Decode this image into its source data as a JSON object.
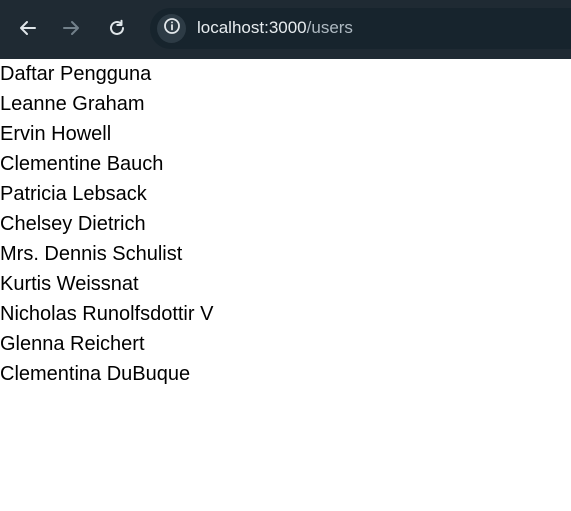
{
  "browser": {
    "url_host": "localhost:3000",
    "url_path": "/users",
    "icons": [
      "back-arrow-icon",
      "forward-arrow-icon",
      "reload-icon",
      "info-icon"
    ]
  },
  "page": {
    "title": "Daftar Pengguna",
    "users": [
      "Leanne Graham",
      "Ervin Howell",
      "Clementine Bauch",
      "Patricia Lebsack",
      "Chelsey Dietrich",
      "Mrs. Dennis Schulist",
      "Kurtis Weissnat",
      "Nicholas Runolfsdottir V",
      "Glenna Reichert",
      "Clementina DuBuque"
    ]
  }
}
